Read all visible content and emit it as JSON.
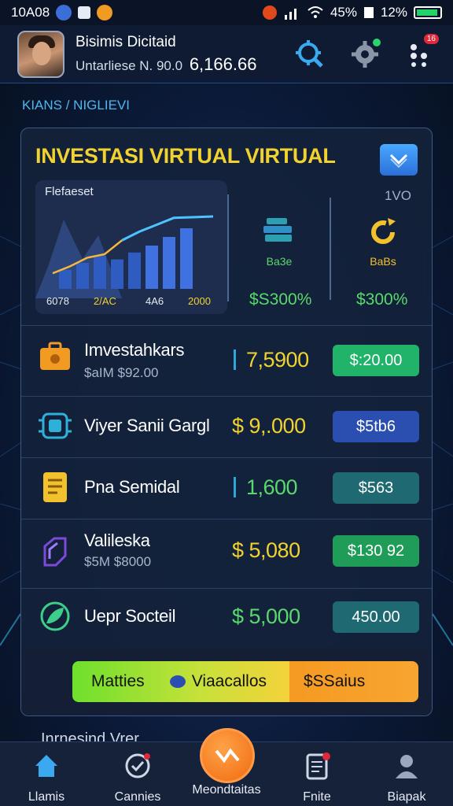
{
  "status_bar": {
    "time": "10A08",
    "battery_percent": "45%",
    "clock_right": "12%"
  },
  "header": {
    "title": "Bisimis Dicitaid",
    "subtitle": "Untarliese N. 90.0",
    "balance": "6,166.66",
    "icons": [
      "search-gear-icon",
      "settings-icon",
      "notifications-icon"
    ],
    "notification_badge": "16"
  },
  "breadcrumb": "KIANS / NIGLIEVI",
  "card": {
    "title": "INVESTASI VIRTUAL VIRTUAL",
    "chart_label": "Flefaeset",
    "stat_top_right": "1VO",
    "stats": [
      {
        "caption": "Ba3e",
        "value": "$S300%",
        "icon": "coins-stack-icon",
        "color": "#59d96b"
      },
      {
        "caption": "BaBs",
        "value": "$300%",
        "icon": "gear-refresh-icon",
        "color": "#f2c12e"
      }
    ]
  },
  "chart_data": {
    "type": "bar",
    "categories": [
      "6078",
      "2/AC",
      "4A6",
      "2000"
    ],
    "values": [
      22,
      30,
      38,
      34,
      42,
      50,
      60,
      70
    ],
    "line": [
      18,
      26,
      36,
      40,
      56,
      66,
      74,
      82
    ],
    "tick_labels": [
      "6078",
      "2/AC",
      "4A6",
      "2000"
    ]
  },
  "investments": [
    {
      "name": "Imvestahkars",
      "sub": "$aIM $92.00",
      "amount": "7,5900",
      "amount_color": "#f2d22e",
      "action": "$:20.00",
      "action_color": "#22b36a",
      "icon": "briefcase-icon",
      "icon_color": "#f29b22"
    },
    {
      "name": "Viyer Sanii Gargl",
      "sub": "",
      "amount": "$ 9,.000",
      "amount_color": "#f2d22e",
      "action": "$5tb6",
      "action_color": "#2b4fb0",
      "icon": "chip-icon",
      "icon_color": "#2fb0d8"
    },
    {
      "name": "Pna Semidal",
      "sub": "",
      "amount": "1,600",
      "amount_color": "#59d96b",
      "action": "$563",
      "action_color": "#1f6a72",
      "icon": "document-icon",
      "icon_color": "#f2c12e"
    },
    {
      "name": "Valileska",
      "sub": "$5M $8000",
      "amount": "$ 5,080",
      "amount_color": "#f2d22e",
      "action": "$130 92",
      "action_color": "#1f9c58",
      "icon": "package-icon",
      "icon_color": "#7b4ad9"
    },
    {
      "name": "Uepr Socteil",
      "sub": "",
      "amount": "$ 5,000",
      "amount_color": "#59d96b",
      "action": "450.00",
      "action_color": "#1f6a72",
      "icon": "leaf-icon",
      "icon_color": "#3dcf8a"
    }
  ],
  "cta": {
    "left_label": "Matties",
    "middle_label": "Viaacallos",
    "right_label": "$SSaius"
  },
  "peek_row": "Inrnesind Vrer",
  "bottom_nav": [
    {
      "label": "Llamis",
      "icon": "home-icon"
    },
    {
      "label": "Cannies",
      "icon": "heart-check-icon"
    },
    {
      "label": "Meondtaitas",
      "icon": "swap-icon"
    },
    {
      "label": "Fnite",
      "icon": "clipboard-icon"
    },
    {
      "label": "Biapak",
      "icon": "profile-icon"
    }
  ]
}
